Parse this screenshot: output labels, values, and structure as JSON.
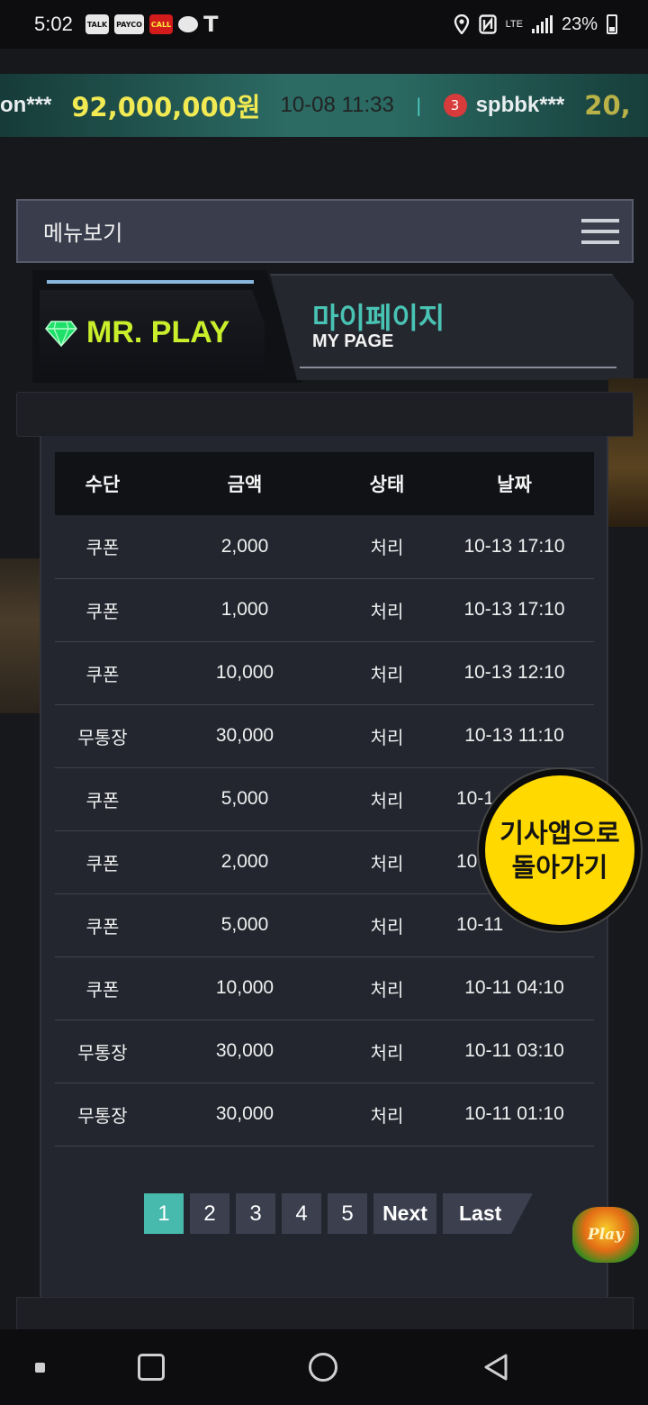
{
  "status_bar": {
    "time": "5:02",
    "icons": [
      "talk-icon",
      "payco-icon",
      "call-icon",
      "chat-bubble-icon",
      "t-icon"
    ],
    "mini_labels": [
      "TALK",
      "PAYCO",
      "CALL"
    ],
    "t_glyph": "T",
    "network": "LTE",
    "battery": "23%"
  },
  "ticker": {
    "user_prefix": "on***",
    "amount": "92,000,000원",
    "date": "10-08 11:33",
    "separator": "|",
    "rank": "3",
    "next_user": "spbbk***",
    "next_amount_partial": "20,"
  },
  "menu": {
    "label": "메뉴보기"
  },
  "header": {
    "brand": "MR. PLAY",
    "title_ko": "마이페이지",
    "title_en": "MY PAGE",
    "brand_color": "#c9ef2c",
    "title_color": "#49c3b4"
  },
  "table": {
    "columns": [
      "수단",
      "금액",
      "상태",
      "날짜"
    ],
    "rows": [
      [
        "쿠폰",
        "2,000",
        "처리",
        "10-13 17:10"
      ],
      [
        "쿠폰",
        "1,000",
        "처리",
        "10-13 17:10"
      ],
      [
        "쿠폰",
        "10,000",
        "처리",
        "10-13 12:10"
      ],
      [
        "무통장",
        "30,000",
        "처리",
        "10-13 11:10"
      ],
      [
        "쿠폰",
        "5,000",
        "처리",
        "10-1"
      ],
      [
        "쿠폰",
        "2,000",
        "처리",
        "10"
      ],
      [
        "쿠폰",
        "5,000",
        "처리",
        "10-11"
      ],
      [
        "쿠폰",
        "10,000",
        "처리",
        "10-11 04:10"
      ],
      [
        "무통장",
        "30,000",
        "처리",
        "10-11 03:10"
      ],
      [
        "무통장",
        "30,000",
        "처리",
        "10-11 01:10"
      ]
    ]
  },
  "pagination": {
    "pages": [
      "1",
      "2",
      "3",
      "4",
      "5"
    ],
    "active": "1",
    "next_label": "Next",
    "last_label": "Last"
  },
  "floating_button": {
    "line1": "기사앱으로",
    "line2": "돌아가기",
    "color": "#ffd900"
  },
  "mascot": {
    "text": "Play"
  }
}
